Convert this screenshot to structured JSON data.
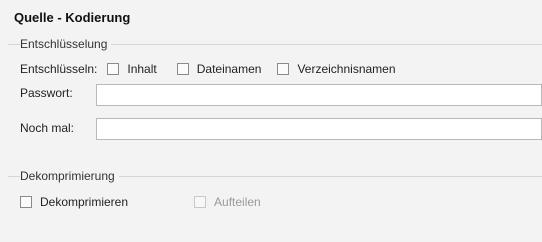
{
  "panel": {
    "title": "Quelle - Kodierung"
  },
  "encryption": {
    "group_label": "Entschlüsselung",
    "decrypt_label": "Entschlüsseln:",
    "options": [
      {
        "label": "Inhalt",
        "checked": false,
        "enabled": true
      },
      {
        "label": "Dateinamen",
        "checked": false,
        "enabled": true
      },
      {
        "label": "Verzeichnisnamen",
        "checked": false,
        "enabled": true
      }
    ],
    "password_label": "Passwort:",
    "password_value": "",
    "repeat_label": "Noch mal:",
    "repeat_value": ""
  },
  "decompression": {
    "group_label": "Dekomprimierung",
    "options": [
      {
        "label": "Dekomprimieren",
        "checked": false,
        "enabled": true
      },
      {
        "label": "Aufteilen",
        "checked": false,
        "enabled": false
      }
    ]
  }
}
